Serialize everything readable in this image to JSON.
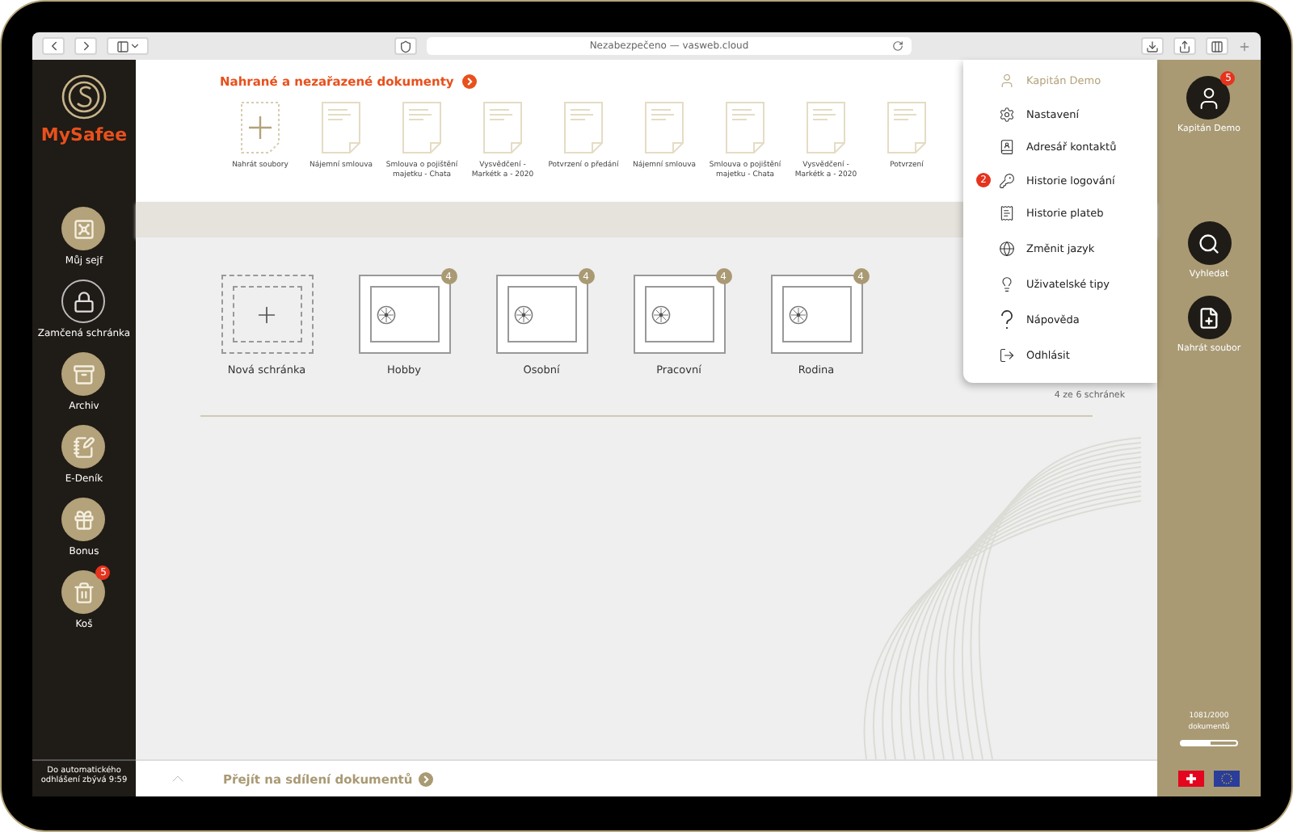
{
  "browser": {
    "address": "Nezabezpečeno — vasweb.cloud"
  },
  "brand": {
    "name": "MySafee"
  },
  "sidebar": {
    "items": [
      {
        "label": "Můj sejf",
        "kind": "vault"
      },
      {
        "label": "Zamčená schránka",
        "kind": "lock"
      },
      {
        "label": "Archiv",
        "kind": "archive"
      },
      {
        "label": "E-Deník",
        "kind": "diary"
      },
      {
        "label": "Bonus",
        "kind": "gift"
      },
      {
        "label": "Koš",
        "kind": "trash",
        "badge": "5"
      }
    ],
    "logout_notice": "Do automatického odhlášení zbývá 9:59"
  },
  "documents": {
    "title": "Nahrané a nezařazené dokumenty",
    "items": [
      {
        "kind": "upload",
        "label": "Nahrát soubory"
      },
      {
        "kind": "document",
        "label": "Nájemní smlouva"
      },
      {
        "kind": "document",
        "label": "Smlouva o pojištění majetku - Chata"
      },
      {
        "kind": "document",
        "label": "Vysvědčení - Markétk a - 2020"
      },
      {
        "kind": "document",
        "label": "Potvrzení o předání"
      },
      {
        "kind": "document",
        "label": "Nájemní smlouva"
      },
      {
        "kind": "document",
        "label": "Smlouva o pojištění majetku - Chata"
      },
      {
        "kind": "document",
        "label": "Vysvědčení - Markétk a - 2020"
      },
      {
        "kind": "document",
        "label": "Potvrzení"
      }
    ]
  },
  "boxes": {
    "items": [
      {
        "kind": "new",
        "label": "Nová schránka"
      },
      {
        "kind": "folder",
        "label": "Hobby",
        "count": "4"
      },
      {
        "kind": "folder",
        "label": "Osobní",
        "count": "4"
      },
      {
        "kind": "folder",
        "label": "Pracovní",
        "count": "4"
      },
      {
        "kind": "folder",
        "label": "Rodina",
        "count": "4"
      }
    ],
    "summary": "4 ze 6 schránek"
  },
  "bottom_bar": {
    "link": "Přejít na sdílení dokumentů"
  },
  "user_menu": {
    "items": [
      {
        "kind": "user",
        "label": "Kapitán Demo"
      },
      {
        "kind": "settings",
        "label": "Nastavení"
      },
      {
        "kind": "contacts",
        "label": "Adresář kontaktů"
      },
      {
        "kind": "history",
        "label": "Historie logování",
        "badge": "2"
      },
      {
        "kind": "payments",
        "label": "Historie plateb"
      },
      {
        "kind": "language",
        "label": "Změnit jazyk"
      },
      {
        "kind": "tips",
        "label": "Uživatelské tipy"
      },
      {
        "kind": "help",
        "label": "Nápověda"
      },
      {
        "kind": "logout",
        "label": "Odhlásit"
      }
    ]
  },
  "right_panel": {
    "user": {
      "name": "Kapitán Demo",
      "badge": "5"
    },
    "actions": [
      {
        "kind": "search",
        "label": "Vyhledat"
      },
      {
        "kind": "upload",
        "label": "Nahrát soubor"
      }
    ],
    "storage": {
      "label": "1081/2000 dokumentů",
      "level": 0.54
    }
  }
}
